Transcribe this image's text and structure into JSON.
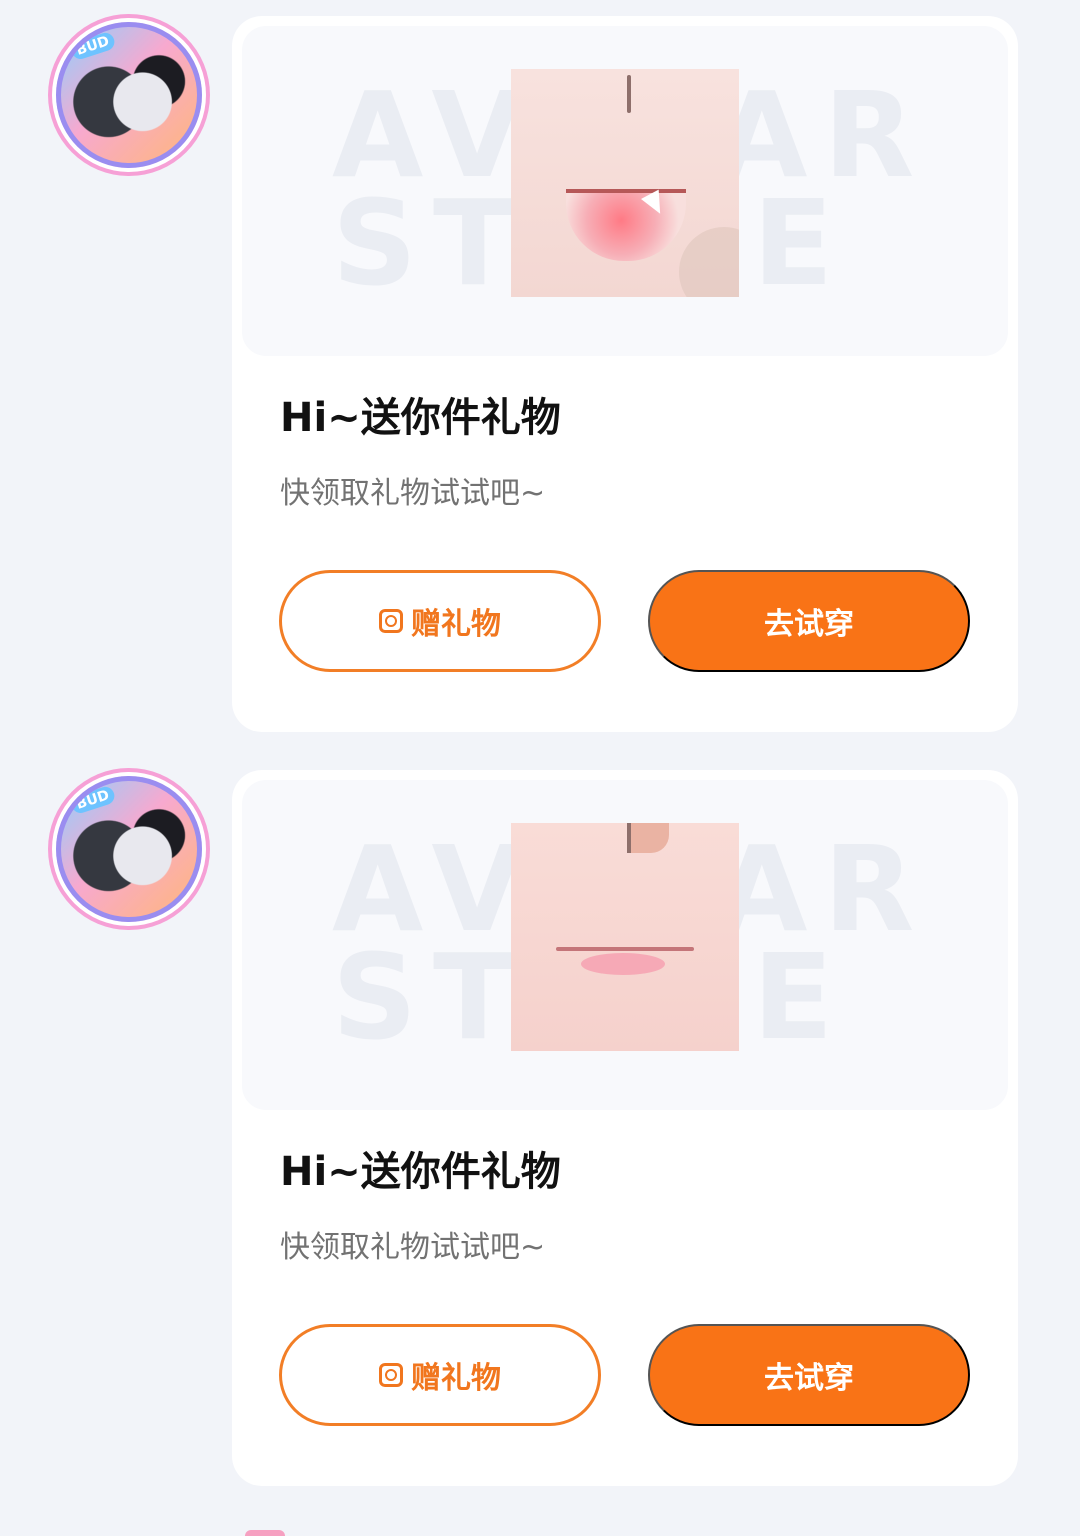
{
  "messages": [
    {
      "avatar_badge": "BUD",
      "title": "Hi~送你件礼物",
      "subtitle": "快领取礼物试试吧~",
      "watermark": "AVATAR STORE",
      "gift_button": "赠礼物",
      "try_button": "去试穿"
    },
    {
      "avatar_badge": "BUD",
      "title": "Hi~送你件礼物",
      "subtitle": "快领取礼物试试吧~",
      "watermark": "AVATAR STORE",
      "gift_button": "赠礼物",
      "try_button": "去试穿"
    }
  ],
  "colors": {
    "accent": "#f97316",
    "background": "#f2f4f9",
    "card": "#ffffff"
  },
  "icons": {
    "gift": "gift-icon"
  }
}
